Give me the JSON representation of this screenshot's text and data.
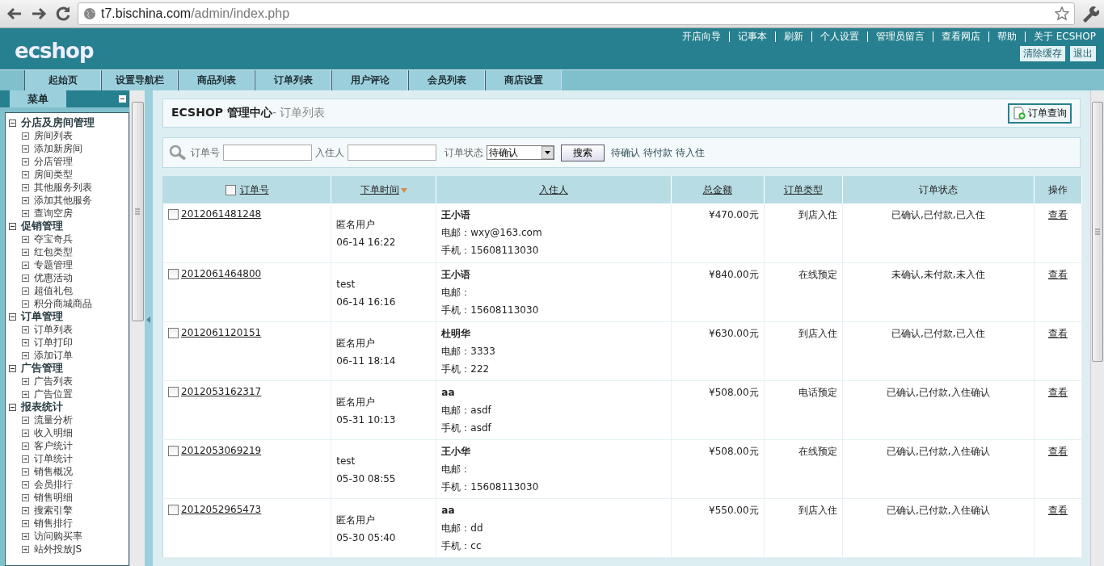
{
  "browser": {
    "url_host": "t7.bischina.com",
    "url_path": "/admin/index.php"
  },
  "header": {
    "logo": "ecshop",
    "links": [
      "开店向导",
      "记事本",
      "刷新",
      "个人设置",
      "管理员留言",
      "查看网店",
      "帮助",
      "关于 ECSHOP"
    ],
    "buttons": [
      "清除缓存",
      "退出"
    ]
  },
  "nav": {
    "tabs": [
      "起始页",
      "设置导航栏",
      "商品列表",
      "订单列表",
      "用户评论",
      "会员列表",
      "商店设置"
    ]
  },
  "sidebar": {
    "title": "菜单",
    "groups": [
      {
        "label": "分店及房间管理",
        "expanded": true,
        "children": [
          "房间列表",
          "添加新房间",
          "分店管理",
          "房间类型",
          "其他服务列表",
          "添加其他服务",
          "查询空房"
        ]
      },
      {
        "label": "促销管理",
        "expanded": true,
        "children": [
          "夺宝奇兵",
          "红包类型",
          "专题管理",
          "优惠活动",
          "超值礼包",
          "积分商城商品"
        ]
      },
      {
        "label": "订单管理",
        "expanded": true,
        "children": [
          "订单列表",
          "订单打印",
          "添加订单"
        ]
      },
      {
        "label": "广告管理",
        "expanded": true,
        "children": [
          "广告列表",
          "广告位置"
        ]
      },
      {
        "label": "报表统计",
        "expanded": true,
        "children": [
          "流量分析",
          "收入明细",
          "客户统计",
          "订单统计",
          "销售概况",
          "会员排行",
          "销售明细",
          "搜索引擎",
          "销售排行",
          "访问购买率",
          "站外投放JS"
        ]
      }
    ]
  },
  "page_title": {
    "site": "ECSHOP 管理中心",
    "section": "- 订单列表",
    "action_button": "订单查询"
  },
  "search": {
    "fields": [
      {
        "label": "订单号"
      },
      {
        "label": "入住人"
      }
    ],
    "status_label": "订单状态",
    "status_value": "待确认",
    "button": "搜索",
    "quick_links": [
      "待确认",
      "待付款",
      "待入住"
    ]
  },
  "table": {
    "select_all_checked": false,
    "columns": [
      {
        "label": "订单号",
        "sortable": true,
        "sorted": false
      },
      {
        "label": "下单时间",
        "sortable": true,
        "sorted": true
      },
      {
        "label": "入住人",
        "sortable": true,
        "sorted": false
      },
      {
        "label": "总金额",
        "sortable": true,
        "sorted": false
      },
      {
        "label": "订单类型",
        "sortable": true,
        "sorted": false
      },
      {
        "label": "订单状态",
        "sortable": false,
        "sorted": false
      },
      {
        "label": "操作",
        "sortable": false,
        "sorted": false
      }
    ],
    "rows": [
      {
        "checked": false,
        "order_no": "2012061481248",
        "buyer": "匿名用户",
        "time": "06-14 16:22",
        "guest": "王小语",
        "email": "电邮：wxy@163.com",
        "phone": "手机：15608113030",
        "amount": "¥470.00元",
        "type": "到店入住",
        "status": "已确认,已付款,已入住",
        "action": "查看"
      },
      {
        "checked": false,
        "order_no": "2012061464800",
        "buyer": "test",
        "time": "06-14 16:16",
        "guest": "王小语",
        "email": "电邮：",
        "phone": "手机：15608113030",
        "amount": "¥840.00元",
        "type": "在线预定",
        "status": "未确认,未付款,未入住",
        "action": "查看"
      },
      {
        "checked": false,
        "order_no": "2012061120151",
        "buyer": "匿名用户",
        "time": "06-11 18:14",
        "guest": "杜明华",
        "email": "电邮：3333",
        "phone": "手机：222",
        "amount": "¥630.00元",
        "type": "到店入住",
        "status": "已确认,已付款,已入住",
        "action": "查看"
      },
      {
        "checked": false,
        "order_no": "2012053162317",
        "buyer": "匿名用户",
        "time": "05-31 10:13",
        "guest": "aa",
        "email": "电邮：asdf",
        "phone": "手机：asdf",
        "amount": "¥508.00元",
        "type": "电话预定",
        "status": "已确认,已付款,入住确认",
        "action": "查看"
      },
      {
        "checked": false,
        "order_no": "2012053069219",
        "buyer": "test",
        "time": "05-30 08:55",
        "guest": "王小华",
        "email": "电邮：",
        "phone": "手机：15608113030",
        "amount": "¥508.00元",
        "type": "在线预定",
        "status": "已确认,已付款,入住确认",
        "action": "查看"
      },
      {
        "checked": false,
        "order_no": "2012052965473",
        "buyer": "匿名用户",
        "time": "05-30 05:40",
        "guest": "aa",
        "email": "电邮：dd",
        "phone": "手机：cc",
        "amount": "¥550.00元",
        "type": "到店入住",
        "status": "已确认,已付款,入住确认",
        "action": "查看"
      }
    ]
  }
}
